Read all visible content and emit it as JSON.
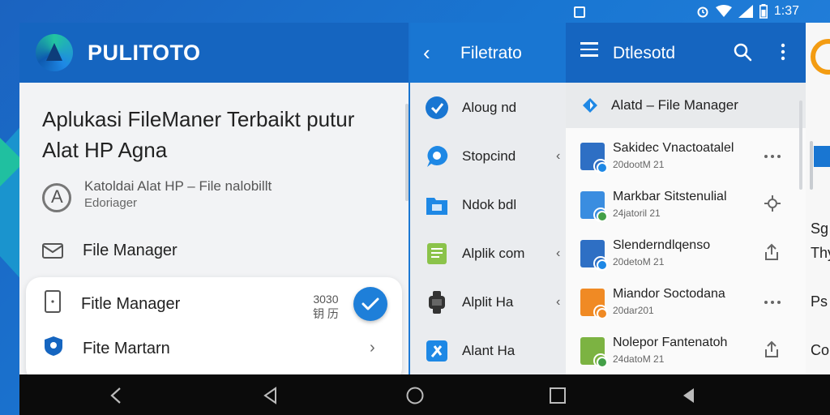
{
  "status_bar": {
    "time": "1:37"
  },
  "panel1": {
    "app_title": "PULITOTO",
    "heading": "Aplukasi FileManer Terbaikt putur Alat HP Agna",
    "info_line1": "Katoldai Alat HP – File nalobillt",
    "info_line2": "Edoriager",
    "row1_label": "File Manager",
    "card": {
      "row1_label": "Fitle Manager",
      "row1_meta_top": "3030",
      "row1_meta_bottom": "钥 历",
      "row2_label": "Fite Martarn"
    }
  },
  "panel2": {
    "title": "Filetrato",
    "items": [
      {
        "label": "Aloug nd",
        "icon": "check-circle-icon",
        "color": "#1976d2"
      },
      {
        "label": "Stopcind",
        "icon": "chat-bubble-icon",
        "color": "#1e88e5"
      },
      {
        "label": "Ndok bdl",
        "icon": "folder-icon",
        "color": "#1e88e5"
      },
      {
        "label": "Alplik com",
        "icon": "document-icon",
        "color": "#8bc34a"
      },
      {
        "label": "Alplit Ha",
        "icon": "watch-icon",
        "color": "#333333"
      },
      {
        "label": "Alant Ha",
        "icon": "tool-icon",
        "color": "#1e88e5"
      }
    ]
  },
  "panel3": {
    "title": "Dtlesotd",
    "bar_label": "Alatd – File Manager",
    "files": [
      {
        "name": "Sakidec Vnactoatalel",
        "date": "20dootM 21",
        "action": "more-horizontal-icon",
        "icon_color": "#2e6fc4",
        "badge_color": "#1e88e5"
      },
      {
        "name": "Markbar Sitstenulial",
        "date": "24jatoril 21",
        "action": "gear-icon",
        "icon_color": "#3a8de0",
        "badge_color": "#43a047"
      },
      {
        "name": "Slenderndlqenso",
        "date": "20detoM 21",
        "action": "share-icon",
        "icon_color": "#2e6fc4",
        "badge_color": "#1e88e5"
      },
      {
        "name": "Miandor Soctodana",
        "date": "20dar201",
        "action": "more-horizontal-icon",
        "icon_color": "#f08a24",
        "badge_color": "#f08a24"
      },
      {
        "name": "Nolepor Fantenatoh",
        "date": "24datoM 21",
        "action": "share-icon",
        "icon_color": "#7cb342",
        "badge_color": "#43a047"
      }
    ]
  },
  "panel4": {
    "lines": [
      "Sg",
      "Thy",
      "Ps",
      "Co"
    ]
  },
  "colors": {
    "primary": "#1565c0",
    "accent": "#1e7fd9",
    "background": "#1976d2"
  }
}
